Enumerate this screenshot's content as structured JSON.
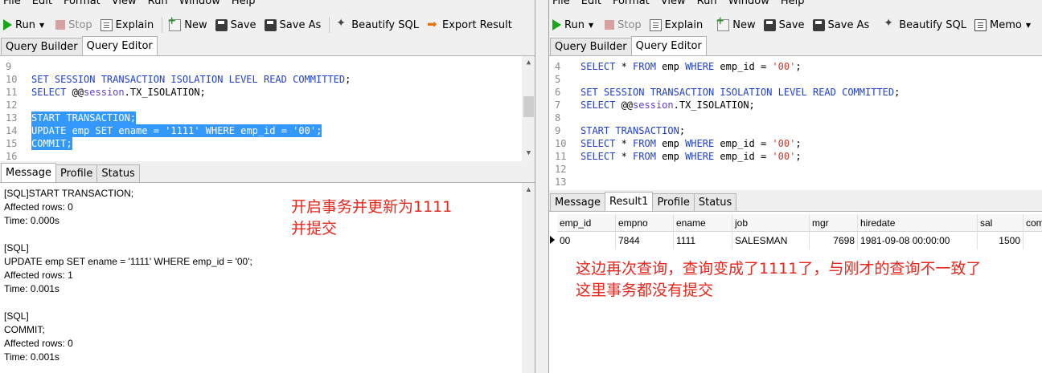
{
  "menu": [
    "File",
    "Edit",
    "Format",
    "View",
    "Run",
    "Window",
    "Help"
  ],
  "left_toolbar": {
    "run": "Run",
    "stop": "Stop",
    "explain": "Explain",
    "new": "New",
    "save": "Save",
    "save_as": "Save As",
    "beautify": "Beautify SQL",
    "export": "Export Result"
  },
  "right_toolbar": {
    "run": "Run",
    "stop": "Stop",
    "explain": "Explain",
    "new": "New",
    "save": "Save",
    "save_as": "Save As",
    "beautify": "Beautify SQL",
    "memo": "Memo"
  },
  "editor_tabs": {
    "builder": "Query Builder",
    "editor": "Query Editor"
  },
  "left_editor": {
    "lines": [
      {
        "n": "9",
        "parts": []
      },
      {
        "n": "10",
        "parts": [
          [
            "kw",
            "SET SESSION TRANSACTION ISOLATION LEVEL READ COMMITTED"
          ],
          [
            "t",
            ";"
          ]
        ]
      },
      {
        "n": "11",
        "parts": [
          [
            "kw",
            "SELECT"
          ],
          [
            "t",
            " @@"
          ],
          [
            "fn",
            "session"
          ],
          [
            "t",
            ".TX_ISOLATION;"
          ]
        ]
      },
      {
        "n": "12",
        "parts": []
      },
      {
        "n": "13",
        "sel": true,
        "parts": [
          [
            "kw",
            "START TRANSACTION"
          ],
          [
            "t",
            ";"
          ]
        ]
      },
      {
        "n": "14",
        "sel": true,
        "parts": [
          [
            "kw",
            "UPDATE"
          ],
          [
            "t",
            " emp "
          ],
          [
            "kw",
            "SET"
          ],
          [
            "t",
            " ename = "
          ],
          [
            "str",
            "'1111'"
          ],
          [
            "t",
            " "
          ],
          [
            "kw",
            "WHERE"
          ],
          [
            "t",
            " emp_id = "
          ],
          [
            "str",
            "'00'"
          ],
          [
            "t",
            ";"
          ]
        ]
      },
      {
        "n": "15",
        "sel": true,
        "parts": [
          [
            "kw",
            "COMMIT"
          ],
          [
            "t",
            ";"
          ]
        ]
      },
      {
        "n": "16",
        "parts": []
      }
    ]
  },
  "right_editor": {
    "lines": [
      {
        "n": "4",
        "parts": [
          [
            "kw",
            "SELECT"
          ],
          [
            "t",
            " * "
          ],
          [
            "kw",
            "FROM"
          ],
          [
            "t",
            " emp "
          ],
          [
            "kw",
            "WHERE"
          ],
          [
            "t",
            " emp_id = "
          ],
          [
            "str",
            "'00'"
          ],
          [
            "t",
            ";"
          ]
        ]
      },
      {
        "n": "5",
        "parts": []
      },
      {
        "n": "6",
        "parts": [
          [
            "kw",
            "SET SESSION TRANSACTION ISOLATION LEVEL READ COMMITTED"
          ],
          [
            "t",
            ";"
          ]
        ]
      },
      {
        "n": "7",
        "parts": [
          [
            "kw",
            "SELECT"
          ],
          [
            "t",
            " @@"
          ],
          [
            "fn",
            "session"
          ],
          [
            "t",
            ".TX_ISOLATION;"
          ]
        ]
      },
      {
        "n": "8",
        "parts": []
      },
      {
        "n": "9",
        "parts": [
          [
            "kw",
            "START TRANSACTION"
          ],
          [
            "t",
            ";"
          ]
        ]
      },
      {
        "n": "10",
        "parts": [
          [
            "kw",
            "SELECT"
          ],
          [
            "t",
            " * "
          ],
          [
            "kw",
            "FROM"
          ],
          [
            "t",
            " emp "
          ],
          [
            "kw",
            "WHERE"
          ],
          [
            "t",
            " emp_id = "
          ],
          [
            "str",
            "'00'"
          ],
          [
            "t",
            ";"
          ]
        ]
      },
      {
        "n": "11",
        "parts": [
          [
            "kw",
            "SELECT"
          ],
          [
            "t",
            " * "
          ],
          [
            "kw",
            "FROM"
          ],
          [
            "t",
            " emp "
          ],
          [
            "kw",
            "WHERE"
          ],
          [
            "t",
            " emp_id = "
          ],
          [
            "str",
            "'00'"
          ],
          [
            "t",
            ";"
          ]
        ]
      },
      {
        "n": "12",
        "parts": []
      },
      {
        "n": "13",
        "parts": []
      }
    ]
  },
  "left_result_tabs": [
    "Message",
    "Profile",
    "Status"
  ],
  "right_result_tabs": [
    "Message",
    "Result1",
    "Profile",
    "Status"
  ],
  "messages": [
    "[SQL]START TRANSACTION;",
    "Affected rows: 0",
    "Time: 0.000s",
    "",
    "[SQL]",
    "UPDATE emp SET ename = '1111' WHERE emp_id = '00';",
    "Affected rows: 1",
    "Time: 0.001s",
    "",
    "[SQL]",
    "COMMIT;",
    "Affected rows: 0",
    "Time: 0.001s"
  ],
  "left_note": [
    "开启事务并更新为1111",
    "并提交"
  ],
  "right_note": [
    "这边再次查询，查询变成了1111了，与刚才的查询不一致了",
    "这里事务都没有提交"
  ],
  "result_grid": {
    "columns": [
      "emp_id",
      "empno",
      "ename",
      "job",
      "mgr",
      "hiredate",
      "sal",
      "com"
    ],
    "rows": [
      [
        "00",
        "7844",
        "1111",
        "SALESMAN",
        "7698",
        "1981-09-08 00:00:00",
        "1500",
        ""
      ]
    ]
  },
  "colors": {
    "selection": "#3399ff",
    "keyword": "#1f3fd0",
    "string": "#c33a2e",
    "note": "#e8261c"
  }
}
